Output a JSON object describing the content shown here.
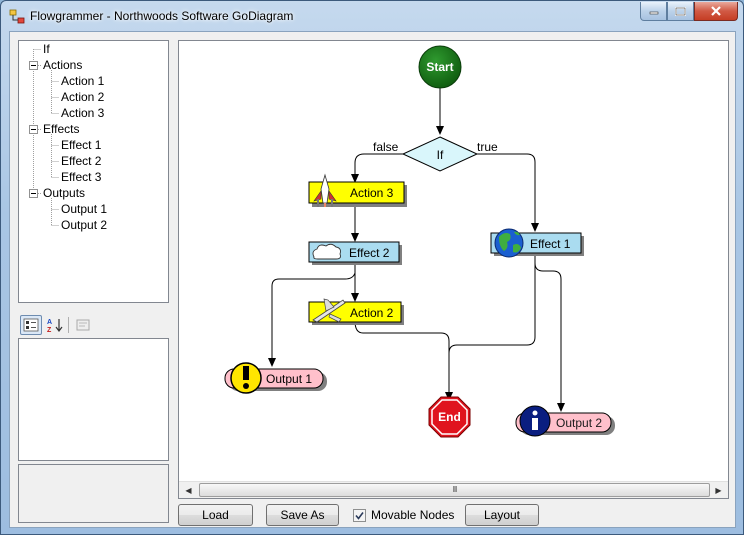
{
  "window": {
    "title": "Flowgrammer - Northwoods Software GoDiagram"
  },
  "tree": {
    "items": [
      {
        "label": "If",
        "level": 0,
        "expandable": false
      },
      {
        "label": "Actions",
        "level": 0,
        "expandable": true
      },
      {
        "label": "Action 1",
        "level": 1,
        "expandable": false
      },
      {
        "label": "Action 2",
        "level": 1,
        "expandable": false
      },
      {
        "label": "Action 3",
        "level": 1,
        "expandable": false
      },
      {
        "label": "Effects",
        "level": 0,
        "expandable": true
      },
      {
        "label": "Effect 1",
        "level": 1,
        "expandable": false
      },
      {
        "label": "Effect 2",
        "level": 1,
        "expandable": false
      },
      {
        "label": "Effect 3",
        "level": 1,
        "expandable": false
      },
      {
        "label": "Outputs",
        "level": 0,
        "expandable": true
      },
      {
        "label": "Output 1",
        "level": 1,
        "expandable": false
      },
      {
        "label": "Output 2",
        "level": 1,
        "expandable": false
      }
    ]
  },
  "diagram": {
    "start": "Start",
    "if": "If",
    "false_label": "false",
    "true_label": "true",
    "action3": "Action 3",
    "effect2": "Effect 2",
    "action2": "Action 2",
    "effect1": "Effect 1",
    "output1": "Output 1",
    "output2": "Output 2",
    "end": "End",
    "colors": {
      "start_fill": "#1a7a1a",
      "if_fill": "#d9f6fb",
      "action_fill": "#ffff00",
      "effect_fill": "#aadcf0",
      "output_fill": "#ffc0cb",
      "end_fill": "#e0141e"
    },
    "icons": {
      "action3": "space-shuttle-icon",
      "effect2": "cloud-icon",
      "action2": "airplane-icon",
      "effect1": "globe-icon",
      "output1": "warning-exclamation-icon",
      "output2": "info-icon"
    }
  },
  "buttons": {
    "load": "Load",
    "save_as": "Save As",
    "layout": "Layout"
  },
  "movable_nodes": {
    "label": "Movable Nodes",
    "checked": true
  },
  "scrollbar": {
    "grip": "III"
  }
}
